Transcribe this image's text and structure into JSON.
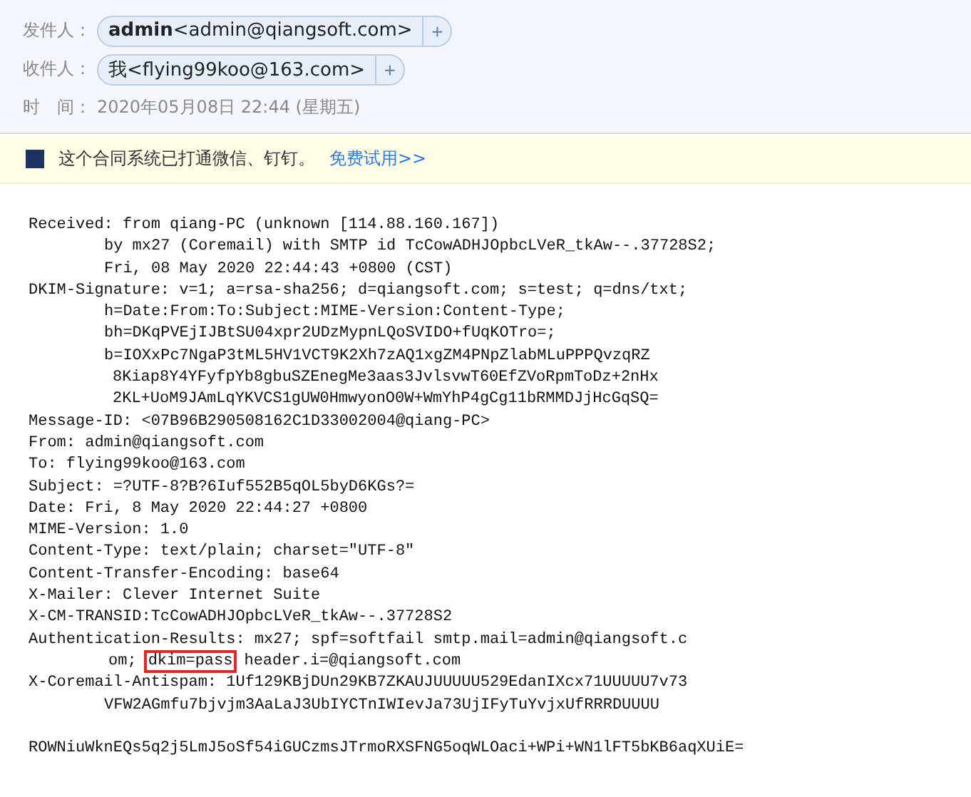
{
  "mail_header": {
    "fields": [
      {
        "kind": "contact",
        "label": "发件人：",
        "chip": "**admin**<admin@qiangsoft.com>",
        "add": "+"
      },
      {
        "kind": "contact",
        "label": "收件人：",
        "chip": "我<flying99koo@163.com>",
        "add": "+"
      },
      {
        "kind": "plain",
        "label": "时　间：",
        "value": "2020年05月08日 22:44 (星期五)"
      }
    ]
  },
  "notice": {
    "text": "这个合同系统已打通微信、钉钉。",
    "link": "免费试用>>"
  },
  "source_lines": [
    {
      "kind": "field",
      "text": "Received: from qiang-PC (unknown [114.88.160.167])"
    },
    {
      "kind": "continuation",
      "text": "by mx27 (Coremail) with SMTP id TcCowADHJOpbcLVeR_tkAw--.37728S2;"
    },
    {
      "kind": "continuation",
      "text": "Fri, 08 May 2020 22:44:43 +0800 (CST)"
    },
    {
      "kind": "field",
      "text": "DKIM-Signature: v=1; a=rsa-sha256; d=qiangsoft.com; s=test; q=dns/txt;"
    },
    {
      "kind": "continuation",
      "text": "h=Date:From:To:Subject:MIME-Version:Content-Type;"
    },
    {
      "kind": "continuation",
      "text": "bh=DKqPVEjIJBtSU04xpr2UDzMypnLQoSVIDO+fUqKOTro=;"
    },
    {
      "kind": "continuation",
      "text": "b=IOXxPc7NgaP3tML5HV1VCT9K2Xh7zAQ1xgZM4PNpZlabMLuPPPQvzqRZ"
    },
    {
      "kind": "deep",
      "text": "8Kiap8Y4YFyfpYb8gbuSZEnegMe3aas3JvlsvwT60EfZVoRpmToDz+2nHx"
    },
    {
      "kind": "deep",
      "text": "2KL+UoM9JAmLqYKVCS1gUW0HmwyonO0W+WmYhP4gCg11bRMMDJjHcGqSQ="
    },
    {
      "kind": "field",
      "text": "Message-ID: <07B96B290508162C1D33002004@qiang-PC>"
    },
    {
      "kind": "field",
      "text": "From: admin@qiangsoft.com"
    },
    {
      "kind": "field",
      "text": "To: flying99koo@163.com"
    },
    {
      "kind": "field",
      "text": "Subject: =?UTF-8?B?6Iuf552B5qOL5byD6KGs?="
    },
    {
      "kind": "field",
      "text": "Date: Fri, 8 May 2020 22:44:27 +0800"
    },
    {
      "kind": "field",
      "text": "MIME-Version: 1.0"
    },
    {
      "kind": "field",
      "text": "Content-Type: text/plain; charset=\"UTF-8\""
    },
    {
      "kind": "field",
      "text": "Content-Transfer-Encoding: base64"
    },
    {
      "kind": "field",
      "text": "X-Mailer: Clever Internet Suite"
    },
    {
      "kind": "field",
      "text": "X-CM-TRANSID:TcCowADHJOpbcLVeR_tkAw--.37728S2"
    },
    {
      "kind": "field",
      "text": "Authentication-Results: mx27; spf=softfail smtp.mail=admin@qiangsoft.c"
    },
    {
      "kind": "continuation",
      "segments": [
        {
          "text": "om;",
          "highlighted": false
        },
        {
          "text": "dkim=pass",
          "highlighted": true
        },
        {
          "text": "header.i=@qiangsoft.com",
          "highlighted": false
        }
      ]
    },
    {
      "kind": "field",
      "text": "X-Coremail-Antispam: 1Uf129KBjDUn29KB7ZKAUJUUUUU529EdanIXcx71UUUUU7v73"
    },
    {
      "kind": "continuation",
      "text": "VFW2AGmfu7bjvjm3AaLaJ3UbIYCTnIWIevJa73UjIFyTuYvjxUfRRRDUUUU"
    },
    {
      "kind": "blank"
    },
    {
      "kind": "field",
      "text": "ROWNiuWknEQs5q2j5LmJ5oSf54iGUCzmsJTrmoRXSFNG5oqWLOaci+WPi+WN1lFT5bKB6aqXUiE="
    }
  ]
}
